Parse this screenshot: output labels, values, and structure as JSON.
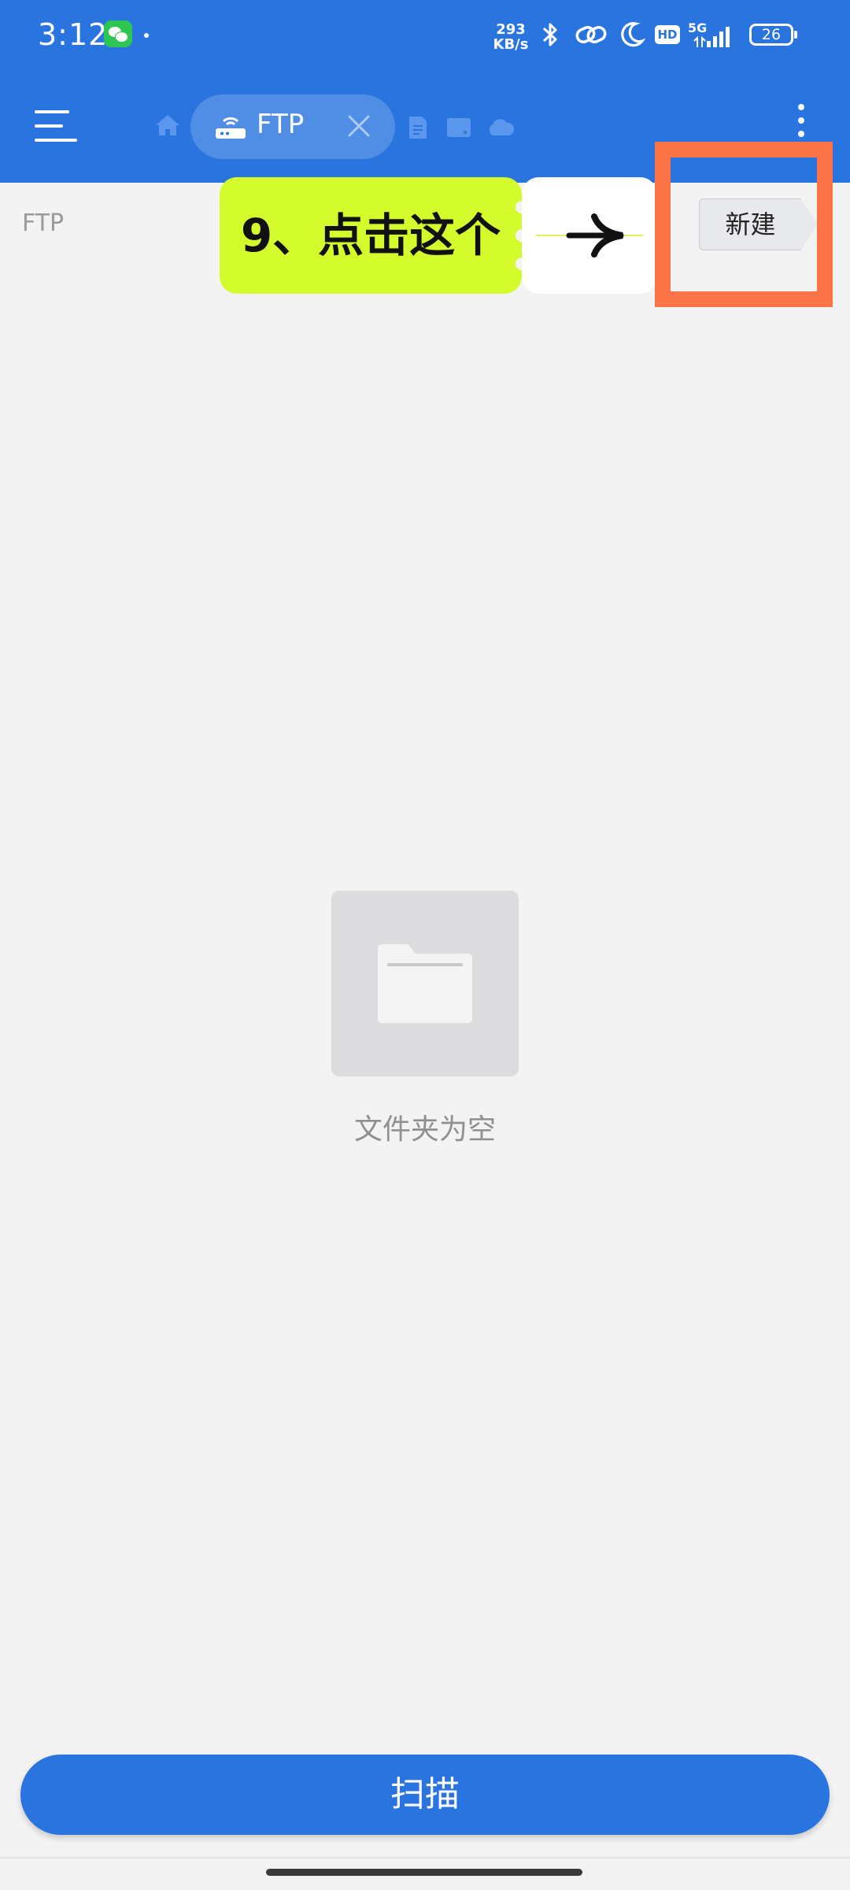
{
  "status_bar": {
    "time": "3:12",
    "net_speed_value": "293",
    "net_speed_unit": "KB/s",
    "hd_label": "HD",
    "network_label": "5G",
    "battery_level": "26",
    "icons": [
      "wechat-icon",
      "bluetooth-icon",
      "link-icon",
      "moon-icon",
      "signal-icon",
      "battery-icon"
    ]
  },
  "header": {
    "menu_icon": "menu-icon",
    "tabs": [
      {
        "icon": "home-icon"
      },
      {
        "icon": "router-icon",
        "label": "FTP",
        "active": true
      },
      {
        "icon": "document-icon"
      },
      {
        "icon": "storage-icon"
      },
      {
        "icon": "cloud-icon"
      }
    ],
    "more_icon": "more-vertical-icon",
    "background_color": "#2a74df"
  },
  "breadcrumb": "FTP",
  "tutorial": {
    "callout_text": "9、点击这个",
    "callout_color": "#d4fb2c",
    "highlight_color": "#fb7447",
    "arrow_icon": "arrow-right-icon"
  },
  "toolbar": {
    "new_label": "新建"
  },
  "empty_state": {
    "icon": "folder-icon",
    "message": "文件夹为空"
  },
  "footer": {
    "scan_label": "扫描"
  }
}
